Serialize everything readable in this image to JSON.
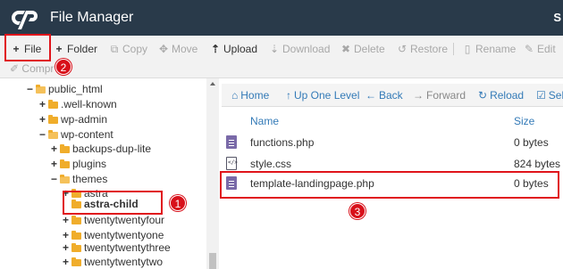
{
  "header": {
    "title": "File Manager",
    "right_char": "S"
  },
  "toolbar": {
    "buttons": [
      {
        "label": "File",
        "icon": "plus"
      },
      {
        "label": "Folder",
        "icon": "plus"
      },
      {
        "label": "Copy",
        "icon": "copy"
      },
      {
        "label": "Move",
        "icon": "move"
      },
      {
        "label": "Upload",
        "icon": "upload"
      },
      {
        "label": "Download",
        "icon": "download"
      },
      {
        "label": "Delete",
        "icon": "x"
      },
      {
        "label": "Restore",
        "icon": "undo"
      },
      {
        "label": "Rename",
        "icon": "file"
      },
      {
        "label": "Edit",
        "icon": "pencil"
      }
    ],
    "row2_label": "Compr"
  },
  "tree": {
    "items": [
      {
        "label": "public_html",
        "toggle": "−"
      },
      {
        "label": ".well-known",
        "toggle": "+"
      },
      {
        "label": "wp-admin",
        "toggle": "+"
      },
      {
        "label": "wp-content",
        "toggle": "−"
      },
      {
        "label": "backups-dup-lite",
        "toggle": "+"
      },
      {
        "label": "plugins",
        "toggle": "+"
      },
      {
        "label": "themes",
        "toggle": "−"
      },
      {
        "label": "astra",
        "toggle": "+"
      },
      {
        "label": "astra-child",
        "toggle": ""
      },
      {
        "label": "twentytwentyfour",
        "toggle": "+"
      },
      {
        "label": "twentytwentyone",
        "toggle": "+"
      },
      {
        "label": "twentytwentythree",
        "toggle": "+"
      },
      {
        "label": "twentytwentytwo",
        "toggle": "+"
      }
    ]
  },
  "nav": {
    "home": "Home",
    "up": "Up One Level",
    "back": "Back",
    "forward": "Forward",
    "reload": "Reload",
    "select": "Sele"
  },
  "table": {
    "col_name": "Name",
    "col_size": "Size",
    "rows": [
      {
        "name": "functions.php",
        "size": "0 bytes",
        "type": "php"
      },
      {
        "name": "style.css",
        "size": "824 bytes",
        "type": "css"
      },
      {
        "name": "template-landingpage.php",
        "size": "0 bytes",
        "type": "php"
      }
    ]
  },
  "annotations": {
    "badge1": "1",
    "badge2": "2",
    "badge3": "3"
  },
  "colors": {
    "header_bg": "#293a4a",
    "link": "#337ab7",
    "annotation": "#e0141b",
    "folder": "#f0ad2b"
  }
}
